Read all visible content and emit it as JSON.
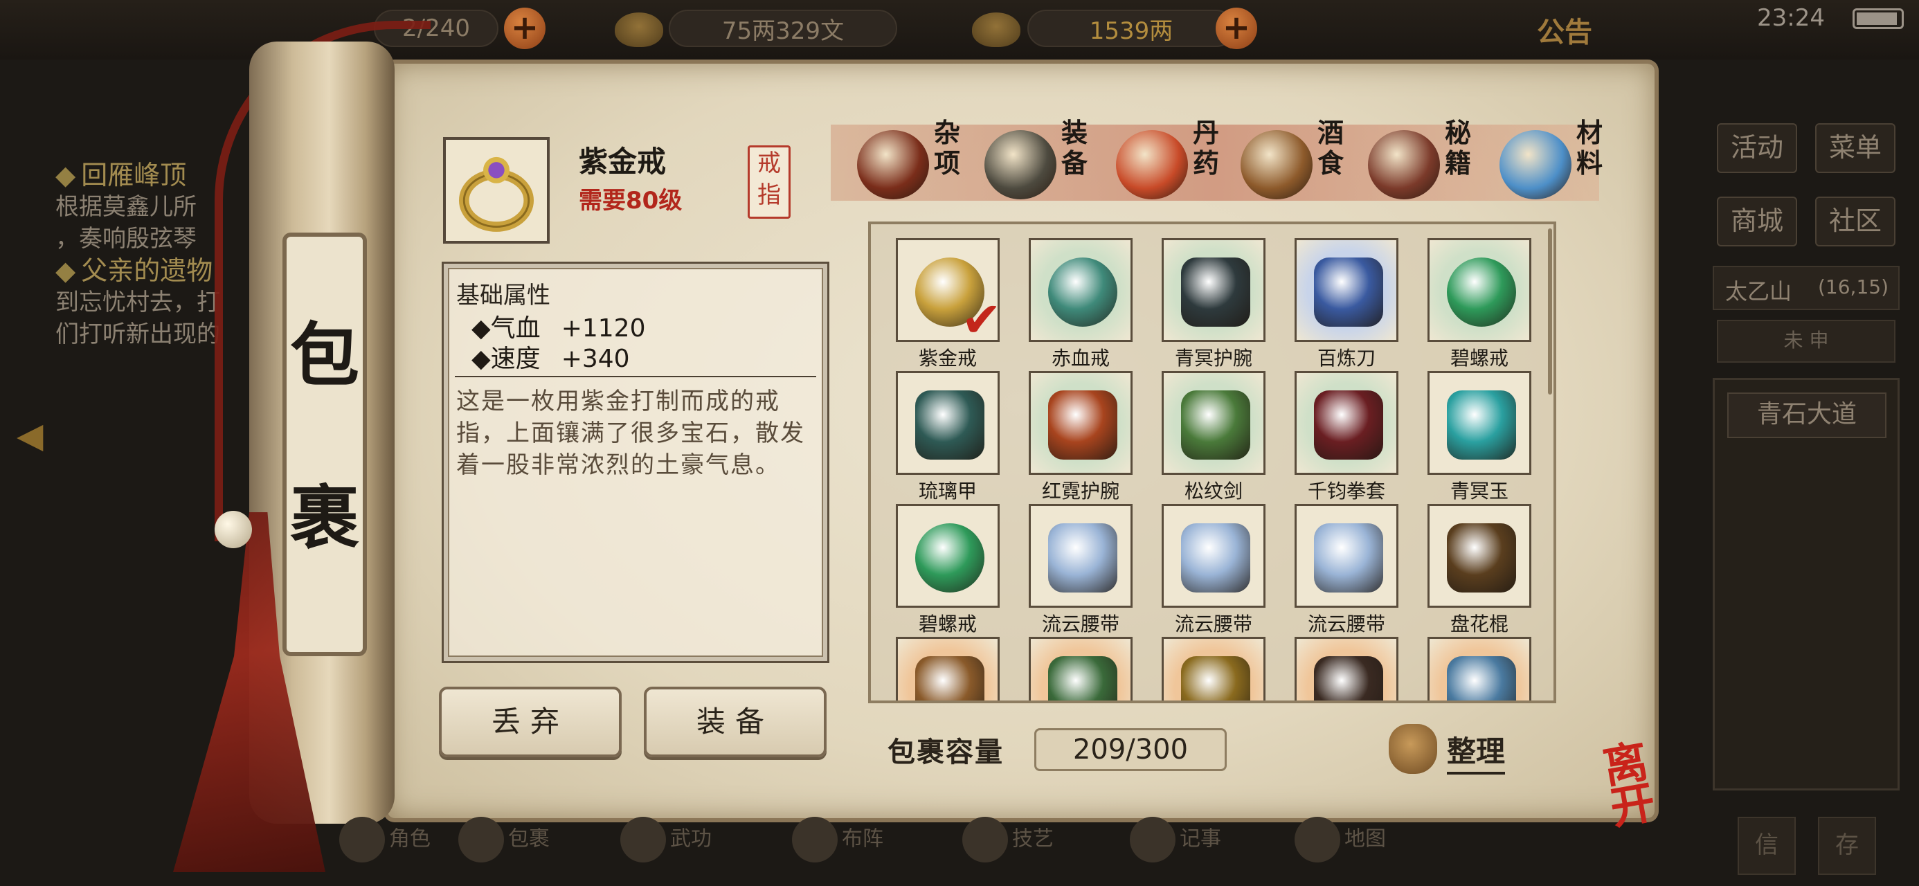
{
  "status": {
    "clock": "23:24",
    "bag_count": "2/240",
    "silver": "75两329文",
    "gold": "1539两",
    "notice_label": "公告"
  },
  "quest": {
    "q1_title": "回雁峰顶",
    "q1_line1": "根据莫鑫儿所",
    "q1_line2": "，奏响殷弦琴",
    "q2_title": "父亲的遗物",
    "q2_line1": "到忘忧村去，打",
    "q2_line2": "们打听新出现的"
  },
  "right_panel": {
    "btn_activity": "活动",
    "btn_menu": "菜单",
    "btn_shop": "商城",
    "btn_community": "社区",
    "location": "太乙山",
    "coords": "(16,15)",
    "time_of_day": "未 申",
    "road": "青石大道"
  },
  "scroll_title": [
    "包",
    "裹"
  ],
  "selected": {
    "name": "紫金戒",
    "requirement": "需要80级",
    "type_seal": "戒指"
  },
  "tabs": [
    {
      "label": "杂项",
      "icon": "jar-icon",
      "color": "#7a2d1a"
    },
    {
      "label": "装备",
      "icon": "equipment-icon",
      "color": "#4d4a3f"
    },
    {
      "label": "丹药",
      "icon": "pills-icon",
      "color": "#c84a28"
    },
    {
      "label": "酒食",
      "icon": "wine-food-icon",
      "color": "#8d5a2b"
    },
    {
      "label": "秘籍",
      "icon": "books-icon",
      "color": "#7b3a2a"
    },
    {
      "label": "材料",
      "icon": "crystal-icon",
      "color": "#4d8fc8"
    }
  ],
  "attributes": {
    "heading": "基础属性",
    "stat1_name": "◆气血",
    "stat1_value": "+1120",
    "stat2_name": "◆速度",
    "stat2_value": "+340",
    "description": "这是一枚用紫金打制而成的戒指，上面镶满了很多宝石，散发着一股非常浓烈的土豪气息。"
  },
  "buttons": {
    "discard": "丢弃",
    "equip": "装备"
  },
  "items": [
    {
      "name": "紫金戒",
      "icon": "gold-ring-icon",
      "color": "#c9a13c",
      "bg": "#efe7d2"
    },
    {
      "name": "赤血戒",
      "icon": "red-ring-icon",
      "color": "#3f8a7a",
      "bg": "#cfe0c8"
    },
    {
      "name": "青冥护腕",
      "icon": "bracer-icon",
      "color": "#2e3a3d",
      "bg": "#cfe0c8"
    },
    {
      "name": "百炼刀",
      "icon": "sword-icon",
      "color": "#3a5aa0",
      "bg": "#c8d4ea"
    },
    {
      "name": "碧螺戒",
      "icon": "jade-ring-icon",
      "color": "#2e9a5a",
      "bg": "#cfe0c8"
    },
    {
      "name": "琉璃甲",
      "icon": "armor-icon",
      "color": "#2e5a55",
      "bg": "#efe7d2"
    },
    {
      "name": "红霓护腕",
      "icon": "red-bracer-icon",
      "color": "#a8441e",
      "bg": "#cfe0c8"
    },
    {
      "name": "松纹剑",
      "icon": "green-sword-icon",
      "color": "#4a7a3a",
      "bg": "#cfe0c8"
    },
    {
      "name": "千钧拳套",
      "icon": "gauntlet-icon",
      "color": "#6a1e22",
      "bg": "#cfe0c8"
    },
    {
      "name": "青冥玉",
      "icon": "jade-pendant-icon",
      "color": "#2aa0a0",
      "bg": "#efe7d2"
    },
    {
      "name": "碧螺戒",
      "icon": "jade-ring-icon",
      "color": "#2e9a5a",
      "bg": "#efe7d2"
    },
    {
      "name": "流云腰带",
      "icon": "belt-icon",
      "color": "#9ab4d6",
      "bg": "#efe7d2"
    },
    {
      "name": "流云腰带",
      "icon": "belt-icon",
      "color": "#9ab4d6",
      "bg": "#efe7d2"
    },
    {
      "name": "流云腰带",
      "icon": "belt-icon",
      "color": "#9ab4d6",
      "bg": "#efe7d2"
    },
    {
      "name": "盘花棍",
      "icon": "staff-icon",
      "color": "#5a3e1e",
      "bg": "#efe7d2"
    },
    {
      "name": "",
      "icon": "bronze-armor-icon",
      "color": "#8a5a2a",
      "bg": "#f0c69a"
    },
    {
      "name": "",
      "icon": "bracer-icon",
      "color": "#3a6a3a",
      "bg": "#f0c69a"
    },
    {
      "name": "",
      "icon": "gold-armor-icon",
      "color": "#8a6a1e",
      "bg": "#f0c69a"
    },
    {
      "name": "",
      "icon": "dark-weapon-icon",
      "color": "#3a2a22",
      "bg": "#f0c69a"
    },
    {
      "name": "",
      "icon": "axe-icon",
      "color": "#4a7aa0",
      "bg": "#f0c69a"
    }
  ],
  "capacity": {
    "label": "包裹容量",
    "value": "209/300"
  },
  "sort_label": "整理",
  "leave_label": "离开",
  "bottom_nav": [
    "角色",
    "包裹",
    "武功",
    "布阵",
    "技艺",
    "记事",
    "地图"
  ],
  "bottom_right": [
    "信",
    "存"
  ]
}
